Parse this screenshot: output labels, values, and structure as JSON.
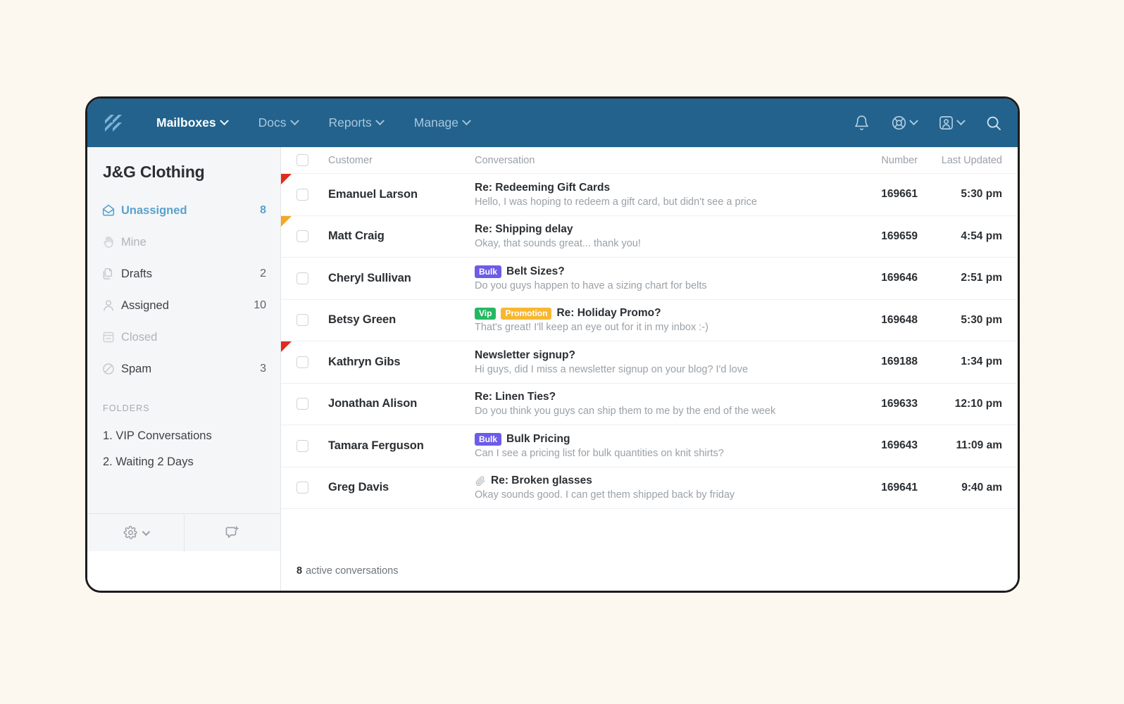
{
  "app": {
    "logo": "helpscout-logo-icon"
  },
  "topnav": {
    "items": [
      {
        "label": "Mailboxes",
        "active": true,
        "caret": true
      },
      {
        "label": "Docs",
        "active": false,
        "caret": true
      },
      {
        "label": "Reports",
        "active": false,
        "caret": true
      },
      {
        "label": "Manage",
        "active": false,
        "caret": true
      }
    ],
    "right_icons": [
      {
        "name": "notifications-bell-icon",
        "caret": false
      },
      {
        "name": "help-lifebuoy-icon",
        "caret": true
      },
      {
        "name": "user-profile-icon",
        "caret": true
      },
      {
        "name": "search-icon",
        "caret": false
      }
    ],
    "background": "#22628d"
  },
  "sidebar": {
    "mailbox_title": "J&G Clothing",
    "items": [
      {
        "label": "Unassigned",
        "count": "8",
        "icon": "envelope-open-icon",
        "state": "active"
      },
      {
        "label": "Mine",
        "count": "",
        "icon": "hand-icon",
        "state": "muted"
      },
      {
        "label": "Drafts",
        "count": "2",
        "icon": "drafts-pages-icon",
        "state": "normal"
      },
      {
        "label": "Assigned",
        "count": "10",
        "icon": "person-icon",
        "state": "normal"
      },
      {
        "label": "Closed",
        "count": "",
        "icon": "archive-icon",
        "state": "muted"
      },
      {
        "label": "Spam",
        "count": "3",
        "icon": "ban-circle-icon",
        "state": "normal"
      }
    ],
    "folders_heading": "FOLDERS",
    "folders": [
      {
        "label": "1. VIP Conversations"
      },
      {
        "label": "2. Waiting 2 Days"
      }
    ],
    "tools": [
      {
        "name": "settings-gear-icon",
        "caret": true
      },
      {
        "name": "new-conversation-icon",
        "caret": false
      }
    ],
    "active_color": "#5aa2cc"
  },
  "list": {
    "columns": {
      "customer": "Customer",
      "conversation": "Conversation",
      "number": "Number",
      "last_updated": "Last Updated"
    },
    "tag_colors": {
      "Bulk": "#6c5ce7",
      "Vip": "#25b862",
      "Promotion": "#f7b731"
    },
    "rows": [
      {
        "flag": "red",
        "customer": "Emanuel Larson",
        "tags": [],
        "attachment": false,
        "subject": "Re: Redeeming Gift Cards",
        "preview": "Hello, I was hoping to redeem a gift card, but didn't see a price",
        "number": "169661",
        "updated": "5:30 pm"
      },
      {
        "flag": "orange",
        "customer": "Matt Craig",
        "tags": [],
        "attachment": false,
        "subject": "Re: Shipping delay",
        "preview": "Okay, that sounds great... thank you!",
        "number": "169659",
        "updated": "4:54 pm"
      },
      {
        "flag": "",
        "customer": "Cheryl Sullivan",
        "tags": [
          "Bulk"
        ],
        "attachment": false,
        "subject": "Belt Sizes?",
        "preview": "Do you guys happen to have a sizing chart for belts",
        "number": "169646",
        "updated": "2:51 pm"
      },
      {
        "flag": "",
        "customer": "Betsy Green",
        "tags": [
          "Vip",
          "Promotion"
        ],
        "attachment": false,
        "subject": "Re: Holiday Promo?",
        "preview": "That's great! I'll keep an eye out for it in my inbox :-)",
        "number": "169648",
        "updated": "5:30 pm"
      },
      {
        "flag": "red",
        "customer": "Kathryn Gibs",
        "tags": [],
        "attachment": false,
        "subject": "Newsletter signup?",
        "preview": "Hi guys, did I miss a newsletter signup on your blog? I'd love",
        "number": "169188",
        "updated": "1:34 pm"
      },
      {
        "flag": "",
        "customer": "Jonathan Alison",
        "tags": [],
        "attachment": false,
        "subject": "Re: Linen Ties?",
        "preview": "Do you think you guys can ship them to me by the end of the week",
        "number": "169633",
        "updated": "12:10 pm"
      },
      {
        "flag": "",
        "customer": "Tamara Ferguson",
        "tags": [
          "Bulk"
        ],
        "attachment": false,
        "subject": "Bulk Pricing",
        "preview": "Can I see a pricing list for bulk quantities on knit shirts?",
        "number": "169643",
        "updated": "11:09 am"
      },
      {
        "flag": "",
        "customer": "Greg Davis",
        "tags": [],
        "attachment": true,
        "subject": "Re: Broken glasses",
        "preview": "Okay sounds good. I can get them shipped back by friday",
        "number": "169641",
        "updated": "9:40 am"
      }
    ],
    "footer_count": "8",
    "footer_label": "active conversations"
  }
}
